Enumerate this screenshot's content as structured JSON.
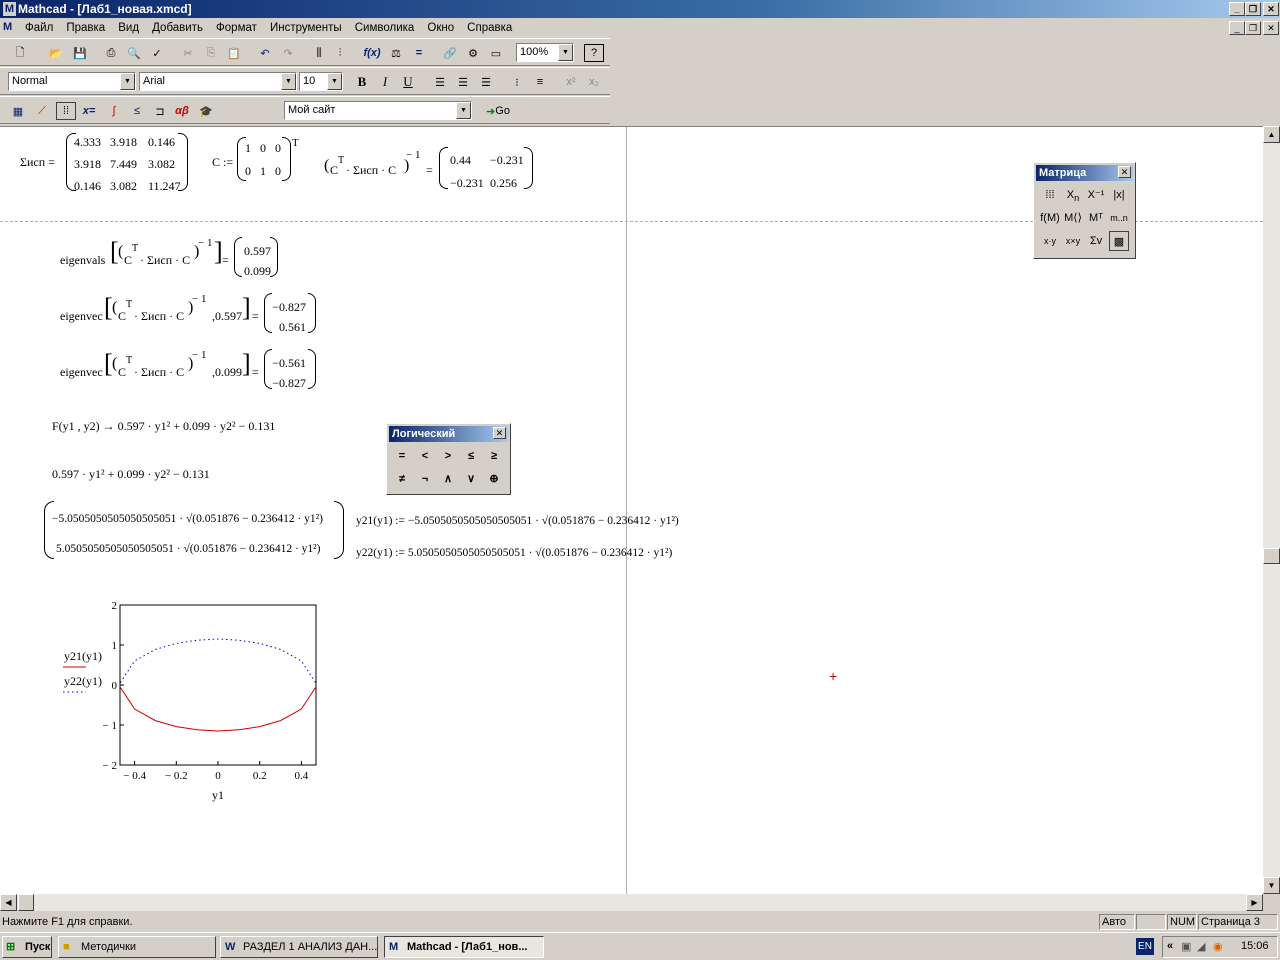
{
  "window": {
    "title": "Mathcad - [Лаб1_новая.xmcd]"
  },
  "menu": [
    "Файл",
    "Правка",
    "Вид",
    "Добавить",
    "Формат",
    "Инструменты",
    "Символика",
    "Окно",
    "Справка"
  ],
  "toolbar": {
    "zoom": "100%",
    "style": "Normal",
    "font": "Arial",
    "font_size": "10",
    "bold": "B",
    "italic": "I",
    "underline": "U",
    "address": "Мой сайт",
    "go_label": "Go"
  },
  "worksheet": {
    "sigma_label": "Σисп =",
    "sigma_matrix": [
      [
        "4.333",
        "3.918",
        "0.146"
      ],
      [
        "3.918",
        "7.449",
        "3.082"
      ],
      [
        "0.146",
        "3.082",
        "11.247"
      ]
    ],
    "c_label": "C :=",
    "c_matrix": [
      [
        "1",
        "0",
        "0"
      ],
      [
        "0",
        "1",
        "0"
      ]
    ],
    "c_transpose": "T",
    "inverse_expr": "C",
    "inverse_sup": "T",
    "inverse_mid": "· Σисп · C",
    "inverse_power": "− 1",
    "inverse_eq": "=",
    "inverse_matrix": [
      [
        "0.44",
        "−0.231"
      ],
      [
        "−0.231",
        "0.256"
      ]
    ],
    "eigenvals_label": "eigenvals",
    "eigenvals_result": [
      "0.597",
      "0.099"
    ],
    "eigenvec1_label": "eigenvec",
    "eigenvec1_arg": ",0.597",
    "eigenvec1_result": [
      "−0.827",
      "0.561"
    ],
    "eigenvec2_label": "eigenvec",
    "eigenvec2_arg": ",0.099",
    "eigenvec2_result": [
      "−0.561",
      "−0.827"
    ],
    "f_def": "F(y1 , y2) → 0.597 · y1² + 0.099 · y2² − 0.131",
    "f_expr": "0.597 · y1² + 0.099 · y2² − 0.131",
    "sol_top": "−5.0505050505050505051 · √(0.051876 − 0.236412 · y1²)",
    "sol_bottom": "5.0505050505050505051 · √(0.051876 − 0.236412 · y1²)",
    "y21_def": "y21(y1) := −5.0505050505050505051 · √(0.051876 − 0.236412 · y1²)",
    "y22_def": "y22(y1) := 5.0505050505050505051 · √(0.051876 − 0.236412 · y1²)"
  },
  "chart_data": {
    "type": "line",
    "xlabel": "y1",
    "ylabel": "",
    "xlim": [
      -0.47,
      0.47
    ],
    "ylim": [
      -2,
      2
    ],
    "x_ticks": [
      "− 0.4",
      "− 0.2",
      "0",
      "0.2",
      "0.4"
    ],
    "y_ticks": [
      "2",
      "1",
      "0",
      "− 1",
      "− 2"
    ],
    "series": [
      {
        "name": "y21(y1)",
        "color": "#cc0000",
        "style": "solid",
        "x": [
          -0.468,
          -0.4,
          -0.3,
          -0.2,
          -0.1,
          0,
          0.1,
          0.2,
          0.3,
          0.4,
          0.468
        ],
        "values": [
          -0.06,
          -0.6,
          -0.89,
          -1.04,
          -1.12,
          -1.15,
          -1.12,
          -1.04,
          -0.89,
          -0.6,
          -0.06
        ]
      },
      {
        "name": "y22(y1)",
        "color": "#0000cc",
        "style": "dotted",
        "x": [
          -0.468,
          -0.4,
          -0.3,
          -0.2,
          -0.1,
          0,
          0.1,
          0.2,
          0.3,
          0.4,
          0.468
        ],
        "values": [
          0.06,
          0.6,
          0.89,
          1.04,
          1.12,
          1.15,
          1.12,
          1.04,
          0.89,
          0.6,
          0.06
        ]
      }
    ],
    "grid": false,
    "legend": "left"
  },
  "palettes": {
    "matrix_title": "Матрица",
    "logic_title": "Логический",
    "logic_buttons": [
      "=",
      "<",
      ">",
      "≤",
      "≥",
      "≠",
      "¬",
      "∧",
      "∨",
      "⊕"
    ]
  },
  "status": {
    "help": "Нажмите F1 для справки.",
    "auto": "Авто",
    "num": "NUM",
    "page": "Страница 3"
  },
  "taskbar": {
    "start": "Пуск",
    "tasks": [
      "Методички",
      "РАЗДЕЛ 1 АНАЛИЗ ДАН...",
      "Mathcad - [Лаб1_нов..."
    ],
    "lang": "EN",
    "clock": "15:06"
  }
}
